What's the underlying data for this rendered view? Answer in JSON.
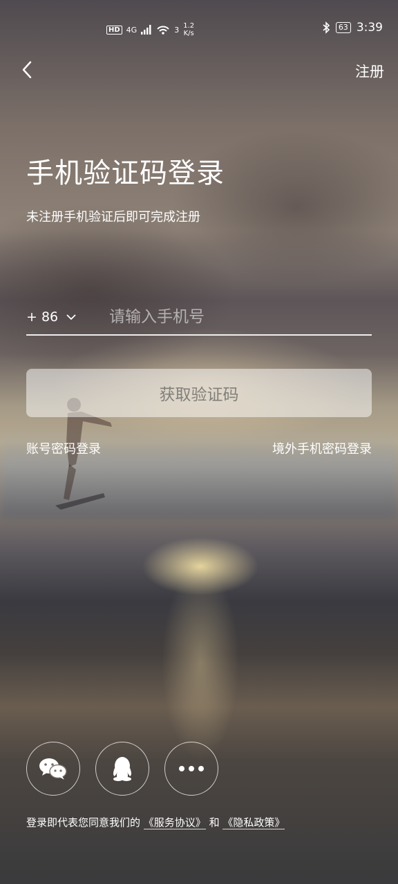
{
  "status_bar": {
    "network": "4G",
    "signal_sup": "3",
    "speed_value": "1.2",
    "speed_unit": "K/s",
    "battery": "63",
    "time": "3:39"
  },
  "nav": {
    "register_label": "注册"
  },
  "page": {
    "title": "手机验证码登录",
    "subtitle": "未注册手机验证后即可完成注册"
  },
  "phone": {
    "country_code": "+ 86",
    "placeholder": "请输入手机号",
    "value": ""
  },
  "actions": {
    "get_code_label": "获取验证码",
    "account_login_label": "账号密码登录",
    "overseas_login_label": "境外手机密码登录"
  },
  "social": {
    "icons": [
      "wechat-icon",
      "qq-icon",
      "more-icon"
    ]
  },
  "footer": {
    "prefix": "登录即代表您同意我们的",
    "service_agreement": "《服务协议》",
    "and": "和",
    "privacy_policy": "《隐私政策》"
  }
}
